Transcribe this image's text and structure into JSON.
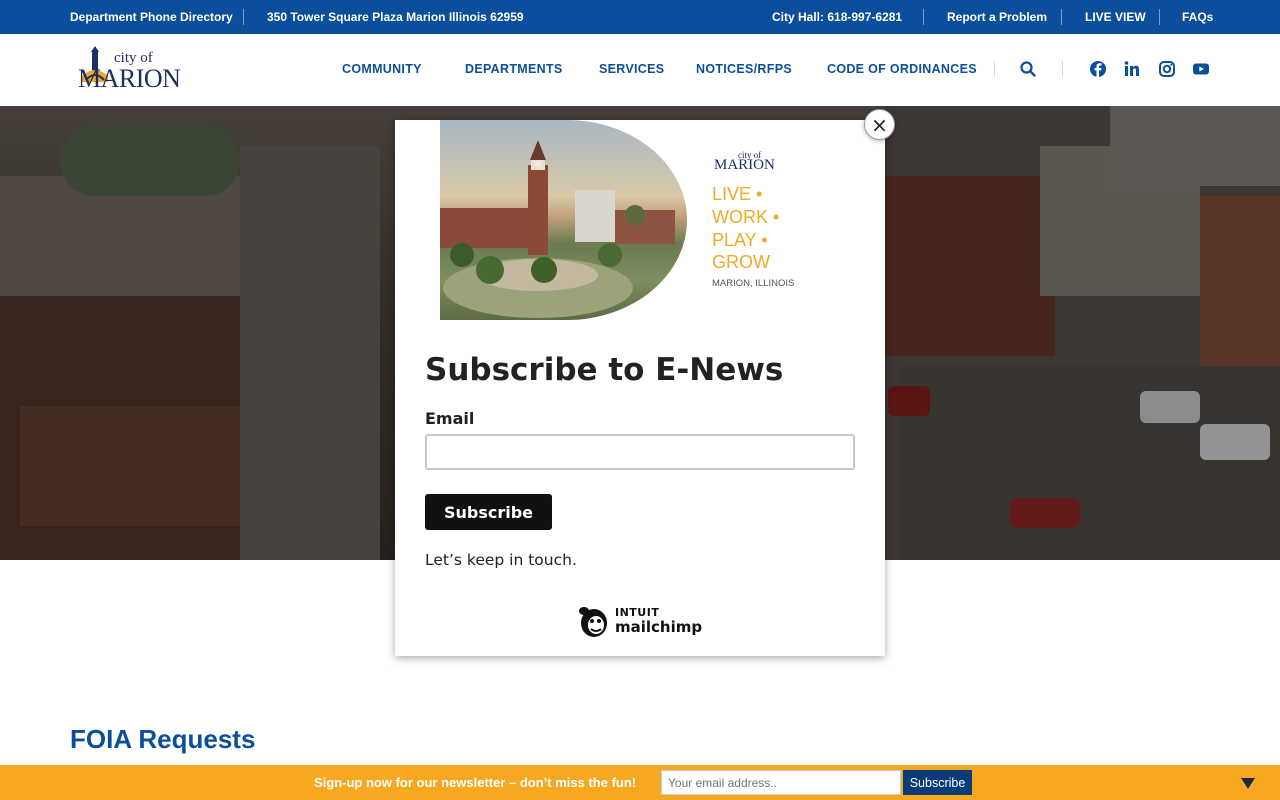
{
  "topbar": {
    "phone_directory": "Department Phone Directory",
    "address": "350 Tower Square Plaza Marion Illinois 62959",
    "city_hall": "City Hall: 618-997-6281",
    "report": "Report a Problem",
    "live_view": "LIVE VIEW",
    "faqs": "FAQs"
  },
  "header": {
    "logo_small": "city of",
    "logo_big": "MARION",
    "nav": [
      "COMMUNITY",
      "DEPARTMENTS",
      "SERVICES",
      "NOTICES/RFPS",
      "CODE OF ORDINANCES"
    ],
    "icons": [
      "search-icon",
      "facebook-icon",
      "linkedin-icon",
      "instagram-icon",
      "youtube-icon"
    ]
  },
  "modal": {
    "close_glyph": "×",
    "promo": {
      "logo_small": "city of",
      "logo_big": "MARION",
      "tag_lines": [
        "LIVE •",
        "WORK •",
        "PLAY •",
        "GROW"
      ],
      "location": "MARION, ILLINOIS"
    },
    "title": "Subscribe to E-News",
    "email_label": "Email",
    "email_value": "",
    "subscribe_label": "Subscribe",
    "note": "Let’s keep in touch.",
    "brand_top": "INTUIT",
    "brand_bottom": "mailchimp"
  },
  "page": {
    "title": "FOIA Requests"
  },
  "newsletter_bar": {
    "text": "Sign-up now for our newsletter – don’t miss the fun!",
    "placeholder": "Your email address..",
    "button": "Subscribe"
  },
  "colors": {
    "brand_blue": "#0b4f9c",
    "accent_orange": "#f6a821",
    "promo_gold": "#f0a92a"
  }
}
